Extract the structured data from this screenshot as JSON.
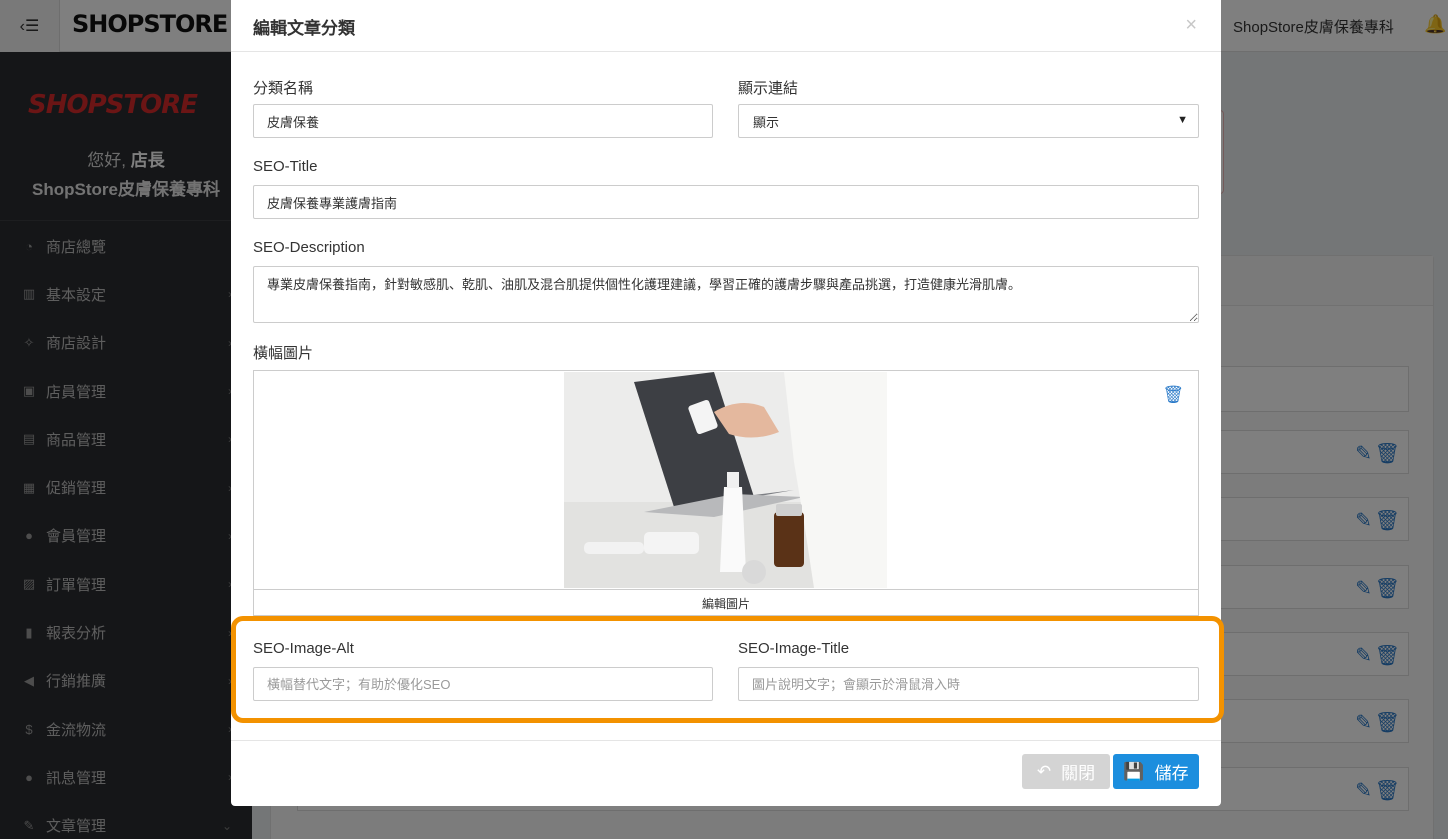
{
  "topbar": {
    "logo": "SHOPSTORE",
    "store_name": "ShopStore皮膚保養專科",
    "toggle_icon": "bars-icon",
    "bell_icon": "bell-icon"
  },
  "sidebar": {
    "brand": "SHOPSTORE",
    "greeting": "您好,",
    "user": "店長",
    "shop": "ShopStore皮膚保養專科",
    "items": [
      {
        "label": "商店總覽",
        "icon": "dashboard-icon"
      },
      {
        "label": "基本設定",
        "icon": "bank-icon"
      },
      {
        "label": "商店設計",
        "icon": "magic-wand-icon"
      },
      {
        "label": "店員管理",
        "icon": "lock-icon"
      },
      {
        "label": "商品管理",
        "icon": "cart-icon"
      },
      {
        "label": "促銷管理",
        "icon": "gift-icon"
      },
      {
        "label": "會員管理",
        "icon": "users-icon"
      },
      {
        "label": "訂單管理",
        "icon": "copy-icon"
      },
      {
        "label": "報表分析",
        "icon": "bar-chart-icon"
      },
      {
        "label": "行銷推廣",
        "icon": "bullhorn-icon"
      },
      {
        "label": "金流物流",
        "icon": "dollar-icon"
      },
      {
        "label": "訊息管理",
        "icon": "comments-icon"
      },
      {
        "label": "文章管理",
        "icon": "edit-icon"
      }
    ]
  },
  "modal": {
    "title": "編輯文章分類",
    "close": "×",
    "category_name_label": "分類名稱",
    "category_name_value": "皮膚保養",
    "show_link_label": "顯示連結",
    "show_link_value": "顯示",
    "seo_title_label": "SEO-Title",
    "seo_title_value": "皮膚保養專業護膚指南",
    "seo_desc_label": "SEO-Description",
    "seo_desc_value": "專業皮膚保養指南，針對敏感肌、乾肌、油肌及混合肌提供個性化護理建議，學習正確的護膚步驟與產品挑選，打造健康光滑肌膚。",
    "banner_label": "橫幅圖片",
    "edit_image": "編輯圖片",
    "seo_alt_label": "SEO-Image-Alt",
    "seo_alt_placeholder": "橫幅替代文字；有助於優化SEO",
    "seo_img_title_label": "SEO-Image-Title",
    "seo_img_title_placeholder": "圖片說明文字；會顯示於滑鼠滑入時",
    "btn_close": "關閉",
    "btn_save": "儲存"
  },
  "colors": {
    "highlight": "#f39200",
    "primary": "#1c8ede",
    "brand_red": "#d72a2a"
  }
}
